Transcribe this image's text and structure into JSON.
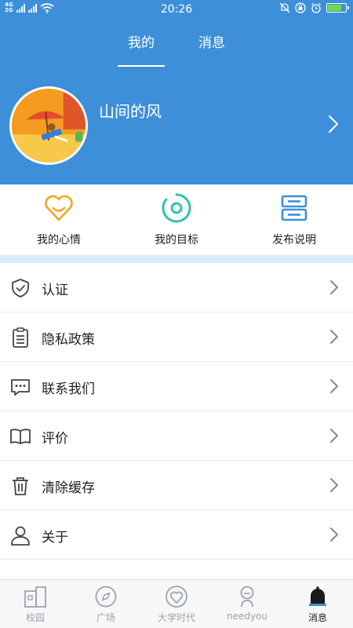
{
  "status_bar": {
    "net_top": "4G",
    "net_bottom": "2G",
    "time": "20:26"
  },
  "header": {
    "tabs": [
      {
        "label": "我的",
        "active": true
      },
      {
        "label": "消息",
        "active": false
      }
    ],
    "username": "山间的风"
  },
  "quick_actions": [
    {
      "label": "我的心情",
      "icon": "heart-smile-icon"
    },
    {
      "label": "我的目标",
      "icon": "target-icon"
    },
    {
      "label": "发布说明",
      "icon": "server-icon"
    }
  ],
  "menu": [
    {
      "label": "认证",
      "icon": "shield-check-icon"
    },
    {
      "label": "隐私政策",
      "icon": "clipboard-icon"
    },
    {
      "label": "联系我们",
      "icon": "chat-icon"
    },
    {
      "label": "评价",
      "icon": "book-icon"
    },
    {
      "label": "清除缓存",
      "icon": "trash-icon"
    },
    {
      "label": "关于",
      "icon": "user-icon"
    }
  ],
  "bottom_nav": [
    {
      "label": "校园",
      "icon": "campus-icon",
      "active": false
    },
    {
      "label": "广场",
      "icon": "compass-icon",
      "active": false
    },
    {
      "label": "大学时代",
      "icon": "heart-circle-icon",
      "active": false
    },
    {
      "label": "needyou",
      "icon": "person-icon",
      "active": false
    },
    {
      "label": "消息",
      "icon": "bell-icon",
      "active": true
    }
  ],
  "colors": {
    "header_bg": "#3d8fd9",
    "accent_orange": "#f5a623",
    "accent_teal": "#2fc4a9",
    "accent_blue": "#3d8fd9",
    "divider_band": "#dcecfb"
  },
  "battery_level": 0.85
}
